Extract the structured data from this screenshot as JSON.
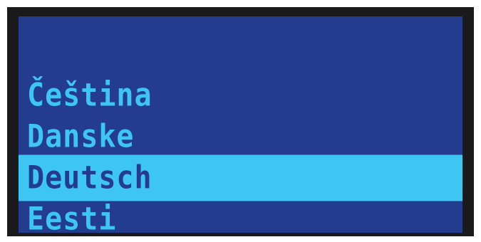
{
  "language_menu": {
    "items": [
      {
        "label": "Čeština",
        "selected": false
      },
      {
        "label": "Danske",
        "selected": false
      },
      {
        "label": "Deutsch",
        "selected": true
      },
      {
        "label": "Eesti",
        "selected": false
      }
    ]
  },
  "colors": {
    "screen_background": "#243c8e",
    "text": "#3cc6f1",
    "highlight": "#3cc6f1",
    "bezel": "#1a1a1a"
  }
}
